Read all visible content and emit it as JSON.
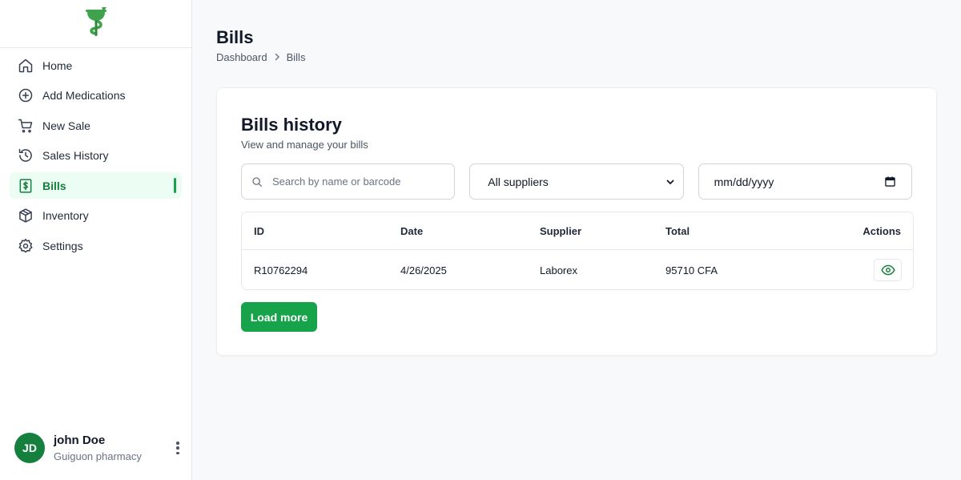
{
  "brand": {
    "accent": "#16a34a",
    "logo_icon": "pharmacy-caduceus-icon"
  },
  "sidebar": {
    "items": [
      {
        "label": "Home",
        "icon": "home-icon",
        "active": false
      },
      {
        "label": "Add Medications",
        "icon": "plus-circle-icon",
        "active": false
      },
      {
        "label": "New Sale",
        "icon": "cart-icon",
        "active": false
      },
      {
        "label": "Sales History",
        "icon": "history-icon",
        "active": false
      },
      {
        "label": "Bills",
        "icon": "bill-icon",
        "active": true
      },
      {
        "label": "Inventory",
        "icon": "box-icon",
        "active": false
      },
      {
        "label": "Settings",
        "icon": "gear-icon",
        "active": false
      }
    ]
  },
  "user": {
    "initials": "JD",
    "name": "john Doe",
    "organization": "Guiguon pharmacy"
  },
  "header": {
    "title": "Bills",
    "breadcrumb": [
      "Dashboard",
      "Bills"
    ]
  },
  "card": {
    "title": "Bills history",
    "subtitle": "View and manage your bills",
    "search": {
      "placeholder": "Search by name or barcode",
      "value": ""
    },
    "supplier_filter": {
      "selected": "All suppliers"
    },
    "date_filter": {
      "value": "mm/dd/yyyy"
    },
    "table": {
      "columns": [
        "ID",
        "Date",
        "Supplier",
        "Total",
        "Actions"
      ],
      "rows": [
        {
          "id": "R10762294",
          "date": "4/26/2025",
          "supplier": "Laborex",
          "total": "95710 CFA",
          "action_icon": "eye-icon"
        }
      ]
    },
    "load_more_label": "Load more"
  }
}
